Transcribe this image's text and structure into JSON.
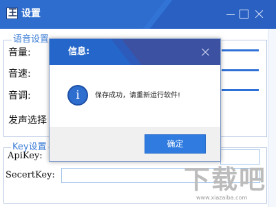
{
  "window": {
    "icon_text": "王",
    "title": "设置"
  },
  "voice_group": {
    "legend": "语音设置",
    "labels": [
      "音量:",
      "音速:",
      "音调:",
      "发声选择"
    ]
  },
  "key_group": {
    "legend": "Key设置",
    "api_key_label": "ApiKey:",
    "api_key_value": "",
    "secret_key_label": "SecertKey:",
    "secret_key_value": ""
  },
  "dialog": {
    "title": "信息:",
    "message": "保存成功，请重新运行软件!",
    "ok_label": "确定",
    "icon_glyph": "i"
  },
  "watermark": {
    "text": "下载吧",
    "url": "www.xiazaiba.com"
  },
  "colors": {
    "accent": "#2e6dce",
    "button": "#2f7be0"
  }
}
